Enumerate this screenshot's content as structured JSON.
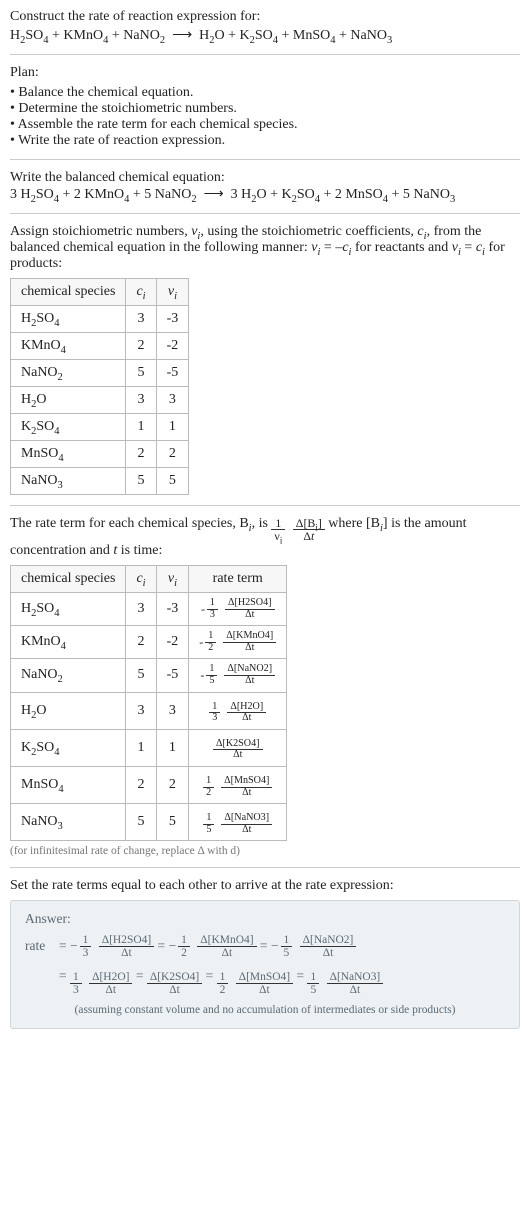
{
  "intro": {
    "prompt": "Construct the rate of reaction expression for:",
    "equation_html": "H<sub>2</sub>SO<sub>4</sub> + KMnO<sub>4</sub> + NaNO<sub>2</sub> &nbsp;⟶&nbsp; H<sub>2</sub>O + K<sub>2</sub>SO<sub>4</sub> + MnSO<sub>4</sub> + NaNO<sub>3</sub>"
  },
  "plan": {
    "heading": "Plan:",
    "steps": [
      "Balance the chemical equation.",
      "Determine the stoichiometric numbers.",
      "Assemble the rate term for each chemical species.",
      "Write the rate of reaction expression."
    ]
  },
  "balanced": {
    "heading": "Write the balanced chemical equation:",
    "equation_html": "3 H<sub>2</sub>SO<sub>4</sub> + 2 KMnO<sub>4</sub> + 5 NaNO<sub>2</sub> &nbsp;⟶&nbsp; 3 H<sub>2</sub>O + K<sub>2</sub>SO<sub>4</sub> + 2 MnSO<sub>4</sub> + 5 NaNO<sub>3</sub>"
  },
  "stoich": {
    "intro_html": "Assign stoichiometric numbers, <span class='ital'>ν<sub>i</sub></span>, using the stoichiometric coefficients, <span class='ital'>c<sub>i</sub></span>, from the balanced chemical equation in the following manner: <span class='ital'>ν<sub>i</sub></span> = –<span class='ital'>c<sub>i</sub></span> for reactants and <span class='ital'>ν<sub>i</sub></span> = <span class='ital'>c<sub>i</sub></span> for products:",
    "headers": {
      "species": "chemical species",
      "ci": "c_i",
      "vi": "ν_i"
    },
    "rows": [
      {
        "species_html": "H<sub>2</sub>SO<sub>4</sub>",
        "ci": "3",
        "vi": "-3"
      },
      {
        "species_html": "KMnO<sub>4</sub>",
        "ci": "2",
        "vi": "-2"
      },
      {
        "species_html": "NaNO<sub>2</sub>",
        "ci": "5",
        "vi": "-5"
      },
      {
        "species_html": "H<sub>2</sub>O",
        "ci": "3",
        "vi": "3"
      },
      {
        "species_html": "K<sub>2</sub>SO<sub>4</sub>",
        "ci": "1",
        "vi": "1"
      },
      {
        "species_html": "MnSO<sub>4</sub>",
        "ci": "2",
        "vi": "2"
      },
      {
        "species_html": "NaNO<sub>3</sub>",
        "ci": "5",
        "vi": "5"
      }
    ]
  },
  "rateterm": {
    "intro_pre_html": "The rate term for each chemical species, B<sub><span class='ital'>i</span></sub>, is ",
    "intro_mid_frac": {
      "coef_num": "1",
      "coef_den_html": "ν<sub>i</sub>",
      "dnum_html": "Δ[B<sub>i</sub>]",
      "dden_html": "Δ<span class='ital'>t</span>"
    },
    "intro_post_html": " where [B<sub><span class='ital'>i</span></sub>] is the amount concentration and <span class='ital'>t</span> is time:",
    "headers": {
      "species": "chemical species",
      "ci": "c_i",
      "vi": "ν_i",
      "rate": "rate term"
    },
    "rows": [
      {
        "species_html": "H<sub>2</sub>SO<sub>4</sub>",
        "ci": "3",
        "vi": "-3",
        "sign": "-",
        "cnum": "1",
        "cden": "3",
        "dnum": "Δ[H2SO4]",
        "dden": "Δt"
      },
      {
        "species_html": "KMnO<sub>4</sub>",
        "ci": "2",
        "vi": "-2",
        "sign": "-",
        "cnum": "1",
        "cden": "2",
        "dnum": "Δ[KMnO4]",
        "dden": "Δt"
      },
      {
        "species_html": "NaNO<sub>2</sub>",
        "ci": "5",
        "vi": "-5",
        "sign": "-",
        "cnum": "1",
        "cden": "5",
        "dnum": "Δ[NaNO2]",
        "dden": "Δt"
      },
      {
        "species_html": "H<sub>2</sub>O",
        "ci": "3",
        "vi": "3",
        "sign": "",
        "cnum": "1",
        "cden": "3",
        "dnum": "Δ[H2O]",
        "dden": "Δt"
      },
      {
        "species_html": "K<sub>2</sub>SO<sub>4</sub>",
        "ci": "1",
        "vi": "1",
        "sign": "",
        "cnum": "",
        "cden": "",
        "dnum": "Δ[K2SO4]",
        "dden": "Δt"
      },
      {
        "species_html": "MnSO<sub>4</sub>",
        "ci": "2",
        "vi": "2",
        "sign": "",
        "cnum": "1",
        "cden": "2",
        "dnum": "Δ[MnSO4]",
        "dden": "Δt"
      },
      {
        "species_html": "NaNO<sub>3</sub>",
        "ci": "5",
        "vi": "5",
        "sign": "",
        "cnum": "1",
        "cden": "5",
        "dnum": "Δ[NaNO3]",
        "dden": "Δt"
      }
    ],
    "footnote": "(for infinitesimal rate of change, replace Δ with d)"
  },
  "final": {
    "heading": "Set the rate terms equal to each other to arrive at the rate expression:"
  },
  "answer": {
    "label": "Answer:",
    "lead": "rate",
    "terms_line1": [
      {
        "eq": "= ",
        "sign": "−",
        "cnum": "1",
        "cden": "3",
        "dnum": "Δ[H2SO4]",
        "dden": "Δt"
      },
      {
        "eq": " = ",
        "sign": "−",
        "cnum": "1",
        "cden": "2",
        "dnum": "Δ[KMnO4]",
        "dden": "Δt"
      },
      {
        "eq": " = ",
        "sign": "−",
        "cnum": "1",
        "cden": "5",
        "dnum": "Δ[NaNO2]",
        "dden": "Δt"
      }
    ],
    "terms_line2": [
      {
        "eq": "= ",
        "sign": "",
        "cnum": "1",
        "cden": "3",
        "dnum": "Δ[H2O]",
        "dden": "Δt"
      },
      {
        "eq": " = ",
        "sign": "",
        "cnum": "",
        "cden": "",
        "dnum": "Δ[K2SO4]",
        "dden": "Δt"
      },
      {
        "eq": " = ",
        "sign": "",
        "cnum": "1",
        "cden": "2",
        "dnum": "Δ[MnSO4]",
        "dden": "Δt"
      },
      {
        "eq": " = ",
        "sign": "",
        "cnum": "1",
        "cden": "5",
        "dnum": "Δ[NaNO3]",
        "dden": "Δt"
      }
    ],
    "assume": "(assuming constant volume and no accumulation of intermediates or side products)"
  },
  "chart_data": {
    "type": "table",
    "title": "Stoichiometric numbers and rate terms",
    "species": [
      "H2SO4",
      "KMnO4",
      "NaNO2",
      "H2O",
      "K2SO4",
      "MnSO4",
      "NaNO3"
    ],
    "c_i": [
      3,
      2,
      5,
      3,
      1,
      2,
      5
    ],
    "nu_i": [
      -3,
      -2,
      -5,
      3,
      1,
      2,
      5
    ],
    "rate_terms": [
      "-(1/3) d[H2SO4]/dt",
      "-(1/2) d[KMnO4]/dt",
      "-(1/5) d[NaNO2]/dt",
      "(1/3) d[H2O]/dt",
      "d[K2SO4]/dt",
      "(1/2) d[MnSO4]/dt",
      "(1/5) d[NaNO3]/dt"
    ],
    "balanced_equation": "3 H2SO4 + 2 KMnO4 + 5 NaNO2 -> 3 H2O + K2SO4 + 2 MnSO4 + 5 NaNO3"
  }
}
